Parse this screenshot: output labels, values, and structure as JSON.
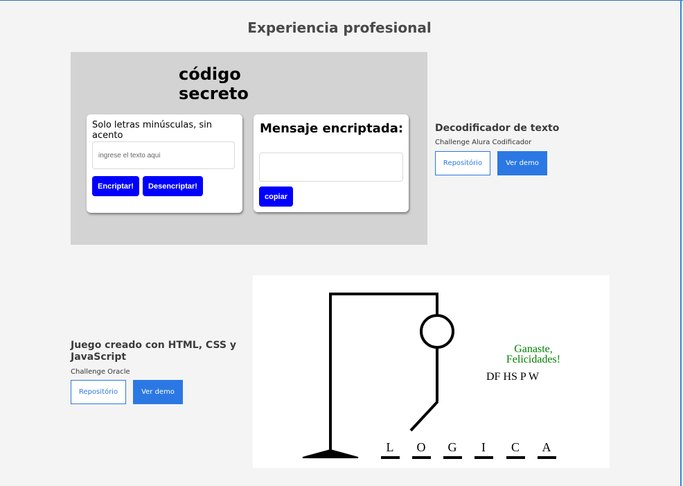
{
  "section": {
    "title": "Experiencia profesional"
  },
  "projects": [
    {
      "name": "Decodificador de texto",
      "subtitle": "Challenge Alura Codificador",
      "repo_label": "Repositório",
      "demo_label": "Ver demo",
      "preview": {
        "title": "código secreto",
        "hint": "Solo letras minúsculas, sin acento",
        "input_placeholder": "ingrese el texto aqui",
        "encrypt_label": "Encriptar!",
        "decrypt_label": "Desencriptar!",
        "message_title": "Mensaje encriptada:",
        "copy_label": "copiar"
      }
    },
    {
      "name": "Juego creado con HTML, CSS y JavaScript",
      "subtitle": "Challenge Oracle",
      "repo_label": "Repositório",
      "demo_label": "Ver demo",
      "preview": {
        "win_message": "Ganaste, Felicidades!",
        "wrong_letters": "DF HS P W",
        "word_letters": [
          "L",
          "O",
          "G",
          "I",
          "C",
          "A"
        ]
      }
    }
  ],
  "colors": {
    "background": "#f4f4f4",
    "accent_blue": "#2b78e4",
    "preview_button_blue": "#0000ff",
    "win_green": "#008000"
  }
}
